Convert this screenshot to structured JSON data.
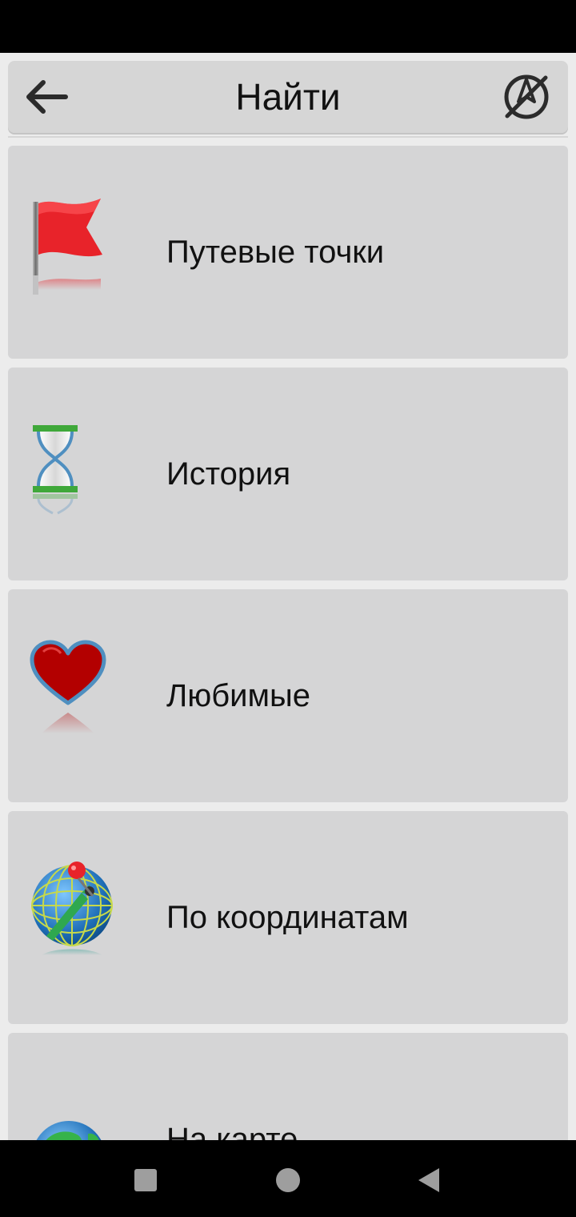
{
  "header": {
    "title": "Найти",
    "back_icon": "arrow-left-icon",
    "action_icon": "navigation-off-icon"
  },
  "menu": [
    {
      "label": "Путевые точки",
      "icon": "red-flag-icon"
    },
    {
      "label": "История",
      "icon": "hourglass-icon"
    },
    {
      "label": "Любимые",
      "icon": "heart-icon"
    },
    {
      "label": "По координатам",
      "icon": "globe-pin-icon"
    },
    {
      "label": "На карте",
      "icon": "earth-globe-icon"
    }
  ],
  "colors": {
    "item_background": "#d5d5d6",
    "page_background": "#ececec",
    "flag_red": "#e8232a",
    "hourglass_green": "#3fa83a",
    "heart_red": "#b30000"
  },
  "system_nav": [
    "recents-square-icon",
    "home-circle-icon",
    "back-triangle-icon"
  ]
}
